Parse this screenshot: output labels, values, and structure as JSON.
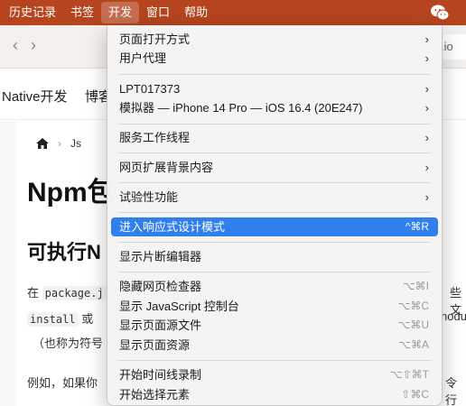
{
  "menubar": {
    "items": [
      "历史记录",
      "书签",
      "开发",
      "窗口",
      "帮助"
    ],
    "active_index": 2
  },
  "toolbar": {
    "tail_text": ".io"
  },
  "site_nav": {
    "links": [
      "Native开发",
      "博客"
    ]
  },
  "page": {
    "breadcrumb": [
      "Js"
    ],
    "heading1": "Npm包",
    "heading2": "可执行N",
    "para1_prefix": "在",
    "para1_code1": "package.j",
    "para1_right": "些文",
    "para2_code": "install",
    "para2_or": "或",
    "para2_right": "nodu",
    "para3": "（也称为符号",
    "para4_left": "例如，如果你",
    "para4_right": "令行"
  },
  "dev_menu": {
    "items": [
      {
        "label": "页面打开方式",
        "submenu": true
      },
      {
        "label": "用户代理",
        "submenu": true
      },
      {
        "label": "LPT017373",
        "submenu": true
      },
      {
        "label": "模拟器 — iPhone 14 Pro — iOS 16.4 (20E247)",
        "submenu": true
      },
      {
        "label": "服务工作线程",
        "submenu": true
      },
      {
        "label": "网页扩展背景内容",
        "submenu": true
      },
      {
        "label": "试验性功能",
        "submenu": true
      },
      {
        "label": "进入响应式设计模式",
        "shortcut": "^⌘R",
        "highlighted": true
      },
      {
        "label": "显示片断编辑器"
      },
      {
        "label": "隐藏网页检查器",
        "shortcut": "⌥⌘I"
      },
      {
        "label": "显示 JavaScript 控制台",
        "shortcut": "⌥⌘C"
      },
      {
        "label": "显示页面源文件",
        "shortcut": "⌥⌘U"
      },
      {
        "label": "显示页面资源",
        "shortcut": "⌥⌘A"
      },
      {
        "label": "开始时间线录制",
        "shortcut": "⌥⇧⌘T"
      },
      {
        "label": "开始选择元素",
        "shortcut": "⇧⌘C"
      }
    ]
  },
  "colors": {
    "menubar_bg": "#b5441f",
    "highlight": "#2f80ed"
  }
}
